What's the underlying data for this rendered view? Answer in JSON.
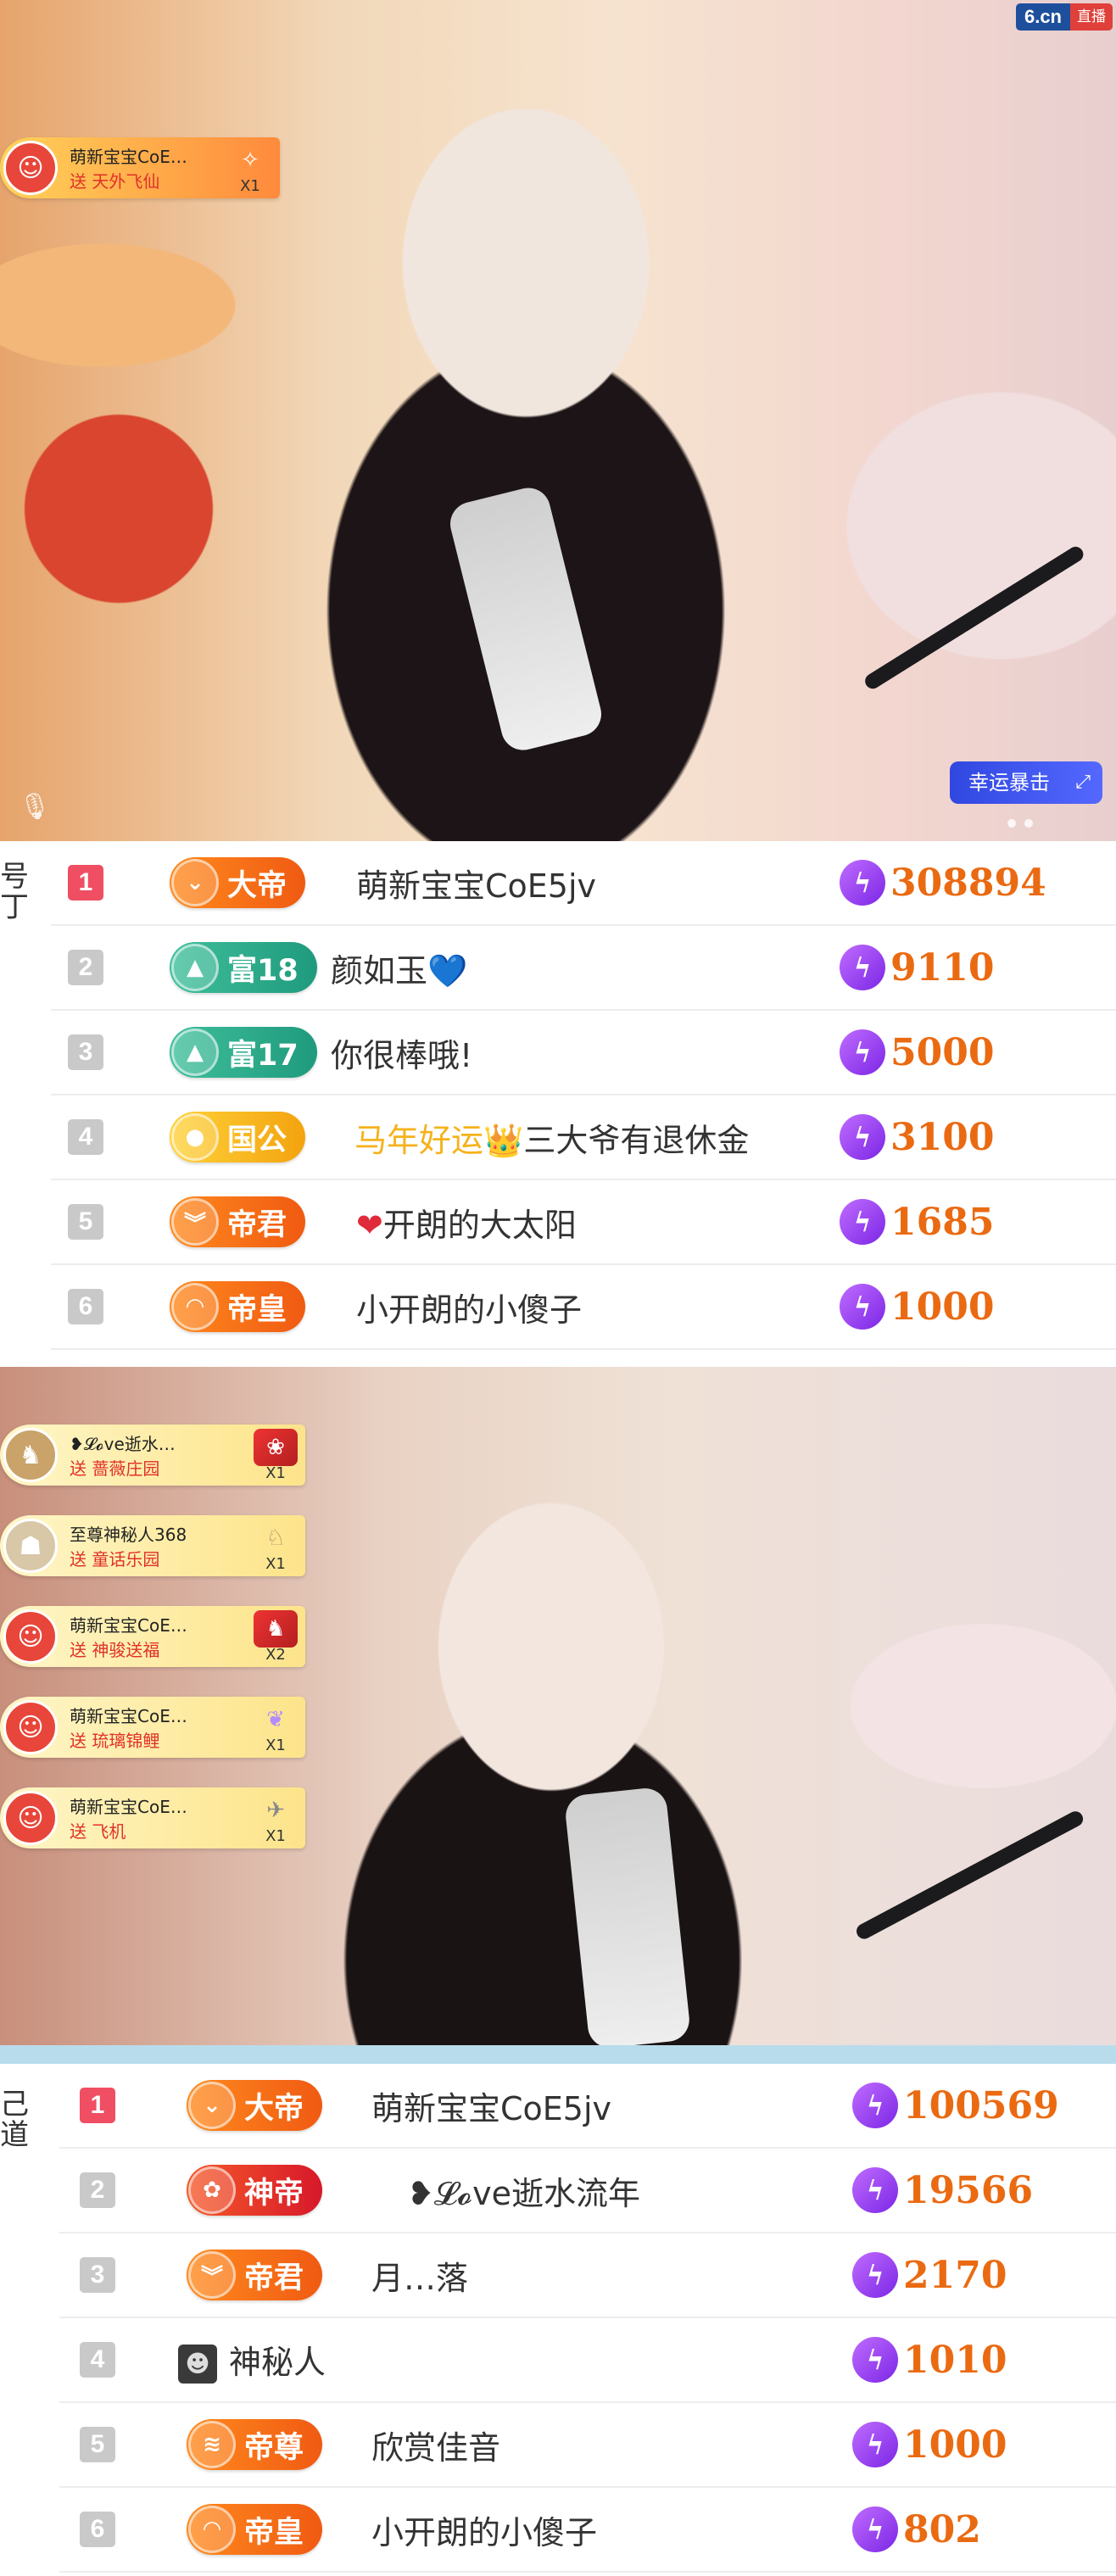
{
  "colors": {
    "accent_orange": "#ea6a12",
    "rank_first": "#ef4e63",
    "rank_other": "#c9c9c9",
    "bolt_purple": "#7b26e5"
  },
  "logo": {
    "main": "6.cn",
    "tag": "直播"
  },
  "video1": {
    "gift_notices": [
      {
        "name": "萌新宝宝CoE…",
        "gift": "送 天外飞仙",
        "count": "X1",
        "avatar_icon": "smile-avatar-icon",
        "gift_icon": "fairy-gift-icon"
      }
    ],
    "lucky_label": "幸运暴击",
    "mic_icon": "microphone-icon"
  },
  "side_text_1": "号\n丁",
  "rank_list_1": [
    {
      "rank": "1",
      "badge": "大帝",
      "badge_style": "orange",
      "name": "萌新宝宝CoE5jv",
      "score": "308894"
    },
    {
      "rank": "2",
      "badge": "富18",
      "badge_style": "teal",
      "name": "颜如玉",
      "name_suffix": "💙",
      "score": "9110"
    },
    {
      "rank": "3",
      "badge": "富17",
      "badge_style": "teal",
      "name": "你很棒哦!",
      "score": "5000"
    },
    {
      "rank": "4",
      "badge": "国公",
      "badge_style": "gold",
      "name_prefix": "马年好运",
      "name_crown": "👑",
      "name": "三大爷有退休金",
      "score": "3100"
    },
    {
      "rank": "5",
      "badge": "帝君",
      "badge_style": "orange",
      "name_heart": "❤",
      "name": "开朗的大太阳",
      "score": "1685"
    },
    {
      "rank": "6",
      "badge": "帝皇",
      "badge_style": "orange",
      "name": "小开朗的小傻子",
      "score": "1000"
    }
  ],
  "video2": {
    "gift_notices": [
      {
        "name": "❥𝓛𝓸ve逝水…",
        "gift": "送 蔷薇庄园",
        "count": "X1",
        "avatar_icon": "knight-avatar-icon",
        "gift_icon": "rose-garden-gift-icon"
      },
      {
        "name": "至尊神秘人368",
        "gift": "送 童话乐园",
        "count": "X1",
        "avatar_icon": "mask-avatar-icon",
        "gift_icon": "carousel-gift-icon"
      },
      {
        "name": "萌新宝宝CoE…",
        "gift": "送 神骏送福",
        "count": "X2",
        "avatar_icon": "smile-avatar-icon",
        "gift_icon": "horse-gift-icon"
      },
      {
        "name": "萌新宝宝CoE…",
        "gift": "送 琉璃锦鲤",
        "count": "X1",
        "avatar_icon": "smile-avatar-icon",
        "gift_icon": "koi-gift-icon"
      },
      {
        "name": "萌新宝宝CoE…",
        "gift": "送 飞机",
        "count": "X1",
        "avatar_icon": "smile-avatar-icon",
        "gift_icon": "airplane-gift-icon"
      }
    ]
  },
  "side_text_2": "己\n道",
  "rank_list_2": [
    {
      "rank": "1",
      "badge": "大帝",
      "badge_style": "orange",
      "name": "萌新宝宝CoE5jv",
      "score": "100569"
    },
    {
      "rank": "2",
      "badge": "神帝",
      "badge_style": "red",
      "name": "❥𝓛𝓸ve逝水流年",
      "score": "19566"
    },
    {
      "rank": "3",
      "badge": "帝君",
      "badge_style": "orange",
      "name": "月…落",
      "score": "2170"
    },
    {
      "rank": "4",
      "name": "神秘人",
      "mystery": true,
      "score": "1010"
    },
    {
      "rank": "5",
      "badge": "帝尊",
      "badge_style": "orange",
      "name": "欣赏佳音",
      "score": "1000"
    },
    {
      "rank": "6",
      "badge": "帝皇",
      "badge_style": "orange",
      "name": "小开朗的小傻子",
      "score": "802"
    }
  ]
}
